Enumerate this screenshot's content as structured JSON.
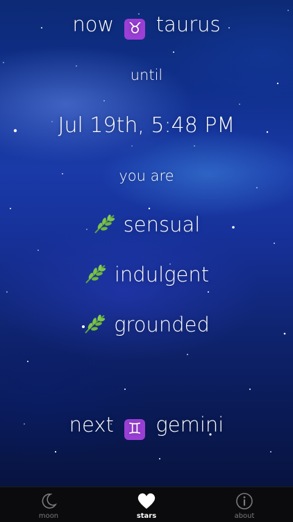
{
  "current": {
    "prefix": "now",
    "sign_symbol": "♉",
    "sign_name": "taurus"
  },
  "until_label": "until",
  "until_date": "Jul 19th, 5:48 PM",
  "you_are_label": "you are",
  "traits": [
    {
      "icon": "herb-icon",
      "label": "sensual"
    },
    {
      "icon": "herb-icon",
      "label": "indulgent"
    },
    {
      "icon": "herb-icon",
      "label": "grounded"
    }
  ],
  "next": {
    "prefix": "next",
    "sign_symbol": "♊",
    "sign_name": "gemini"
  },
  "tabbar": {
    "tabs": [
      {
        "label": "moon",
        "icon": "moon-icon",
        "active": false
      },
      {
        "label": "stars",
        "icon": "heart-icon",
        "active": true
      },
      {
        "label": "about",
        "icon": "info-icon",
        "active": false
      }
    ]
  },
  "colors": {
    "sign_badge": "#9b3fd6",
    "tabbar_bg": "#0b0b0d",
    "tab_inactive": "#7a7a80",
    "tab_active": "#ffffff"
  }
}
